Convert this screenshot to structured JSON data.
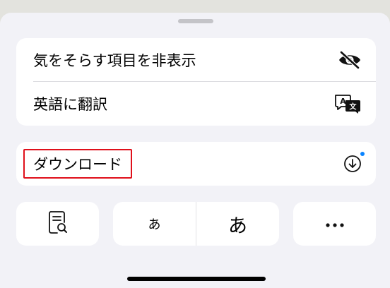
{
  "menu": {
    "hide_distractions_label": "気をそらす項目を非表示",
    "translate_label": "英語に翻訳",
    "download_label": "ダウンロード"
  },
  "toolbar": {
    "small_text_label": "あ",
    "large_text_label": "あ",
    "more_label": "•••"
  },
  "icons": {
    "hide": "eye-slash-icon",
    "translate": "translate-icon",
    "download": "download-circle-icon",
    "reader": "reader-search-icon",
    "more": "ellipsis-icon"
  },
  "colors": {
    "highlight": "#e0101b",
    "badge_dot": "#0a84ff"
  }
}
